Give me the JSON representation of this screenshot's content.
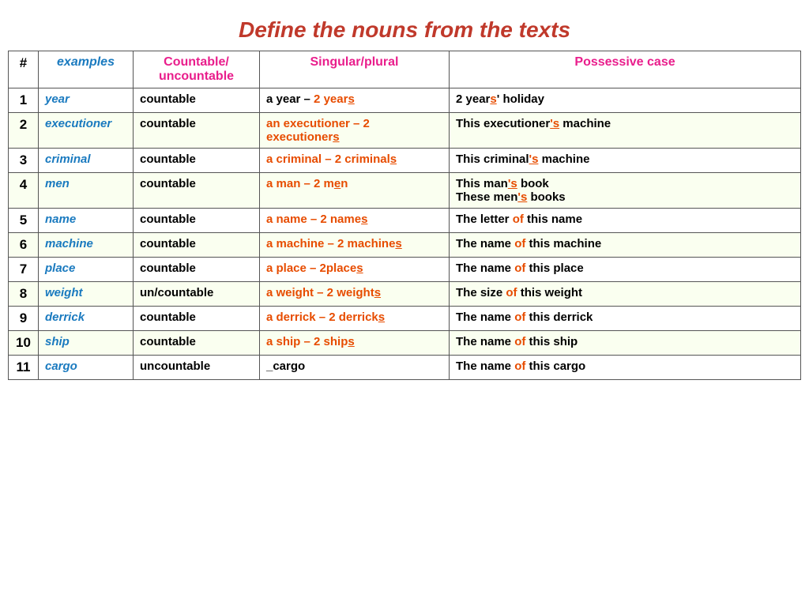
{
  "title": "Define the nouns  from the texts",
  "headers": {
    "num": "#",
    "examples": "examples",
    "countable": "Countable/ uncountable",
    "singular_plural": "Singular/plural",
    "possessive": "Possessive case"
  },
  "rows": [
    {
      "num": "1",
      "example": "year",
      "countable": "countable",
      "sp_parts": [
        {
          "text": "a year ",
          "type": "normal"
        },
        {
          "text": "–",
          "type": "normal"
        },
        {
          "text": " 2 year",
          "type": "orange"
        },
        {
          "text": "s",
          "type": "under"
        }
      ],
      "poss_parts": [
        {
          "text": "2 year",
          "type": "normal"
        },
        {
          "text": "s",
          "type": "poss-s"
        },
        {
          "text": "' holiday",
          "type": "normal"
        }
      ]
    },
    {
      "num": "2",
      "example": "executioner",
      "countable": "countable",
      "sp_parts": [
        {
          "text": "an executioner ",
          "type": "orange"
        },
        {
          "text": "– 2 executioner",
          "type": "orange"
        },
        {
          "text": "s",
          "type": "under"
        }
      ],
      "poss_parts": [
        {
          "text": "This executioner",
          "type": "normal"
        },
        {
          "text": "'s",
          "type": "poss-s"
        },
        {
          "text": " machine",
          "type": "normal"
        }
      ]
    },
    {
      "num": "3",
      "example": "criminal",
      "countable": "countable",
      "sp_parts": [
        {
          "text": "a criminal – 2 criminal",
          "type": "orange"
        },
        {
          "text": "s",
          "type": "under"
        }
      ],
      "poss_parts": [
        {
          "text": "This criminal",
          "type": "normal"
        },
        {
          "text": "'s",
          "type": "poss-s"
        },
        {
          "text": " machine",
          "type": "normal"
        }
      ]
    },
    {
      "num": "4",
      "example": "men",
      "countable": "countable",
      "sp_parts": [
        {
          "text": "a man – 2 m",
          "type": "orange"
        },
        {
          "text": "e",
          "type": "under"
        },
        {
          "text": "n",
          "type": "orange"
        }
      ],
      "poss_parts": [
        {
          "text": "This man",
          "type": "normal"
        },
        {
          "text": "'s",
          "type": "poss-s"
        },
        {
          "text": " book",
          "type": "normal"
        },
        {
          "text": "\nThese men",
          "type": "normal"
        },
        {
          "text": "'s",
          "type": "poss-s"
        },
        {
          "text": " books",
          "type": "normal"
        }
      ]
    },
    {
      "num": "5",
      "example": "name",
      "countable": "countable",
      "sp_parts": [
        {
          "text": "a name – 2 name",
          "type": "orange"
        },
        {
          "text": "s",
          "type": "under"
        }
      ],
      "poss_parts": [
        {
          "text": "The letter ",
          "type": "normal"
        },
        {
          "text": "of",
          "type": "of"
        },
        {
          "text": " this name",
          "type": "normal"
        }
      ]
    },
    {
      "num": "6",
      "example": "machine",
      "countable": "countable",
      "sp_parts": [
        {
          "text": "a machine – 2 machine",
          "type": "orange"
        },
        {
          "text": "s",
          "type": "under"
        }
      ],
      "poss_parts": [
        {
          "text": "The name ",
          "type": "normal"
        },
        {
          "text": "of",
          "type": "of"
        },
        {
          "text": " this machine",
          "type": "normal"
        }
      ]
    },
    {
      "num": "7",
      "example": "place",
      "countable": "countable",
      "sp_parts": [
        {
          "text": "a place – 2place",
          "type": "orange"
        },
        {
          "text": "s",
          "type": "under"
        }
      ],
      "poss_parts": [
        {
          "text": "The name ",
          "type": "normal"
        },
        {
          "text": "of",
          "type": "of"
        },
        {
          "text": " this place",
          "type": "normal"
        }
      ]
    },
    {
      "num": "8",
      "example": "weight",
      "countable": "un/countable",
      "sp_parts": [
        {
          "text": "a weight – 2 weight",
          "type": "orange"
        },
        {
          "text": "s",
          "type": "under"
        }
      ],
      "poss_parts": [
        {
          "text": "The size ",
          "type": "normal"
        },
        {
          "text": "of",
          "type": "of"
        },
        {
          "text": " this weight",
          "type": "normal"
        }
      ]
    },
    {
      "num": "9",
      "example": "derrick",
      "countable": "countable",
      "sp_parts": [
        {
          "text": "a derrick – 2 derrick",
          "type": "orange"
        },
        {
          "text": "s",
          "type": "under"
        }
      ],
      "poss_parts": [
        {
          "text": "The name ",
          "type": "normal"
        },
        {
          "text": "of",
          "type": "of"
        },
        {
          "text": " this derrick",
          "type": "normal"
        }
      ]
    },
    {
      "num": "10",
      "example": "ship",
      "countable": "countable",
      "sp_parts": [
        {
          "text": "a ship – 2 ship",
          "type": "orange"
        },
        {
          "text": "s",
          "type": "under"
        }
      ],
      "poss_parts": [
        {
          "text": "The name ",
          "type": "normal"
        },
        {
          "text": "of",
          "type": "of"
        },
        {
          "text": " this ship",
          "type": "normal"
        }
      ]
    },
    {
      "num": "11",
      "example": "cargo",
      "countable": "uncountable",
      "sp_parts": [
        {
          "text": "_cargo",
          "type": "normal"
        }
      ],
      "poss_parts": [
        {
          "text": "The name ",
          "type": "normal"
        },
        {
          "text": "of",
          "type": "of"
        },
        {
          "text": " this cargo",
          "type": "normal"
        }
      ]
    }
  ]
}
